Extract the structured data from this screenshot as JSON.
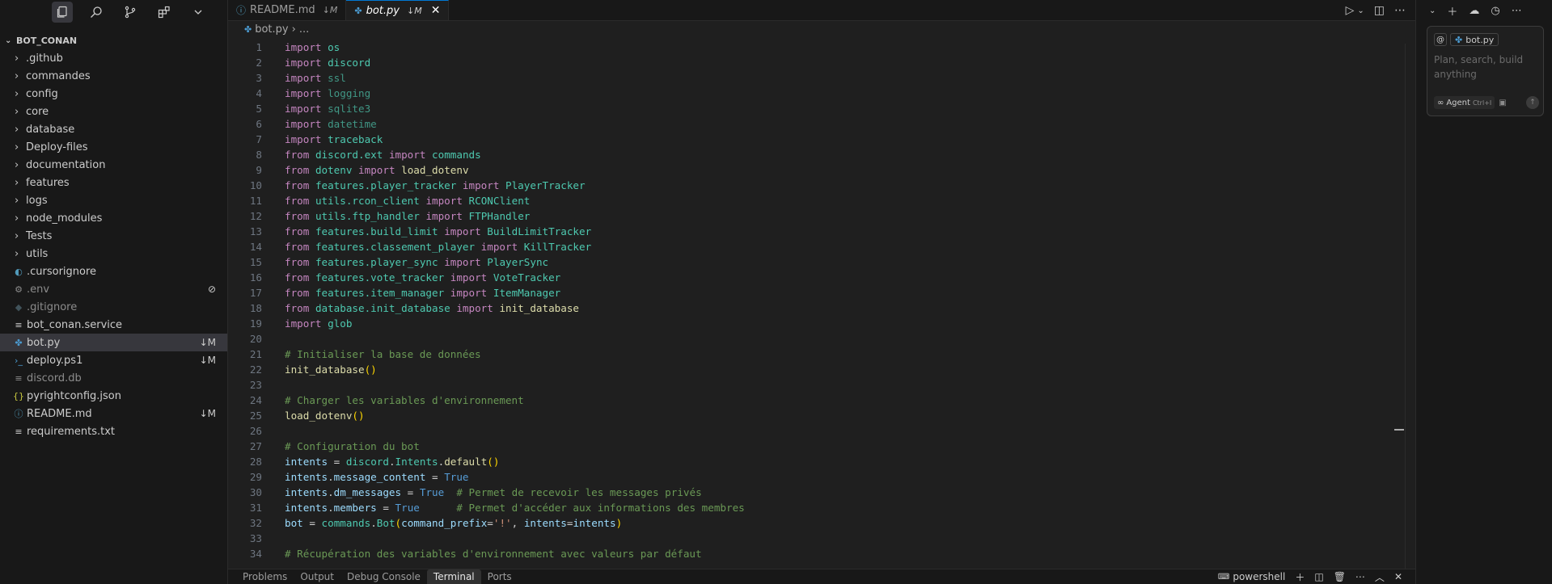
{
  "sidebar": {
    "project_title": "BOT_CONAN",
    "items": [
      {
        "label": ".github",
        "type": "folder",
        "status": ""
      },
      {
        "label": "commandes",
        "type": "folder",
        "status": ""
      },
      {
        "label": "config",
        "type": "folder",
        "status": ""
      },
      {
        "label": "core",
        "type": "folder",
        "status": ""
      },
      {
        "label": "database",
        "type": "folder",
        "status": ""
      },
      {
        "label": "Deploy-files",
        "type": "folder",
        "status": ""
      },
      {
        "label": "documentation",
        "type": "folder",
        "status": ""
      },
      {
        "label": "features",
        "type": "folder",
        "status": ""
      },
      {
        "label": "logs",
        "type": "folder",
        "status": ""
      },
      {
        "label": "node_modules",
        "type": "folder",
        "status": ""
      },
      {
        "label": "Tests",
        "type": "folder",
        "status": ""
      },
      {
        "label": "utils",
        "type": "folder",
        "status": ""
      },
      {
        "label": ".cursorignore",
        "type": "file",
        "status": ""
      },
      {
        "label": ".env",
        "type": "file",
        "status": "⊘"
      },
      {
        "label": ".gitignore",
        "type": "file",
        "status": ""
      },
      {
        "label": "bot_conan.service",
        "type": "file",
        "status": ""
      },
      {
        "label": "bot.py",
        "type": "file",
        "status": "↓M"
      },
      {
        "label": "deploy.ps1",
        "type": "file",
        "status": "↓M"
      },
      {
        "label": "discord.db",
        "type": "file",
        "status": ""
      },
      {
        "label": "pyrightconfig.json",
        "type": "file",
        "status": ""
      },
      {
        "label": "README.md",
        "type": "file",
        "status": "↓M"
      },
      {
        "label": "requirements.txt",
        "type": "file",
        "status": ""
      }
    ]
  },
  "tabs": [
    {
      "label": "README.md",
      "status": "↓M"
    },
    {
      "label": "bot.py",
      "status": "↓M"
    }
  ],
  "breadcrumb": {
    "file": "bot.py",
    "more": "..."
  },
  "code_lines": [
    "1",
    "2",
    "3",
    "4",
    "5",
    "6",
    "7",
    "8",
    "9",
    "10",
    "11",
    "12",
    "13",
    "14",
    "15",
    "16",
    "17",
    "18",
    "19",
    "20",
    "21",
    "22",
    "23",
    "24",
    "25",
    "26",
    "27",
    "28",
    "29",
    "30",
    "31",
    "32",
    "33",
    "34"
  ],
  "panel": {
    "tabs": [
      "Problems",
      "Output",
      "Debug Console",
      "Terminal",
      "Ports"
    ],
    "active_tab": "Terminal",
    "shell": "powershell"
  },
  "chat": {
    "context_chip": "bot.py",
    "placeholder": "Plan, search, build anything",
    "mode": "Agent",
    "shortcut": "Ctrl+I"
  }
}
